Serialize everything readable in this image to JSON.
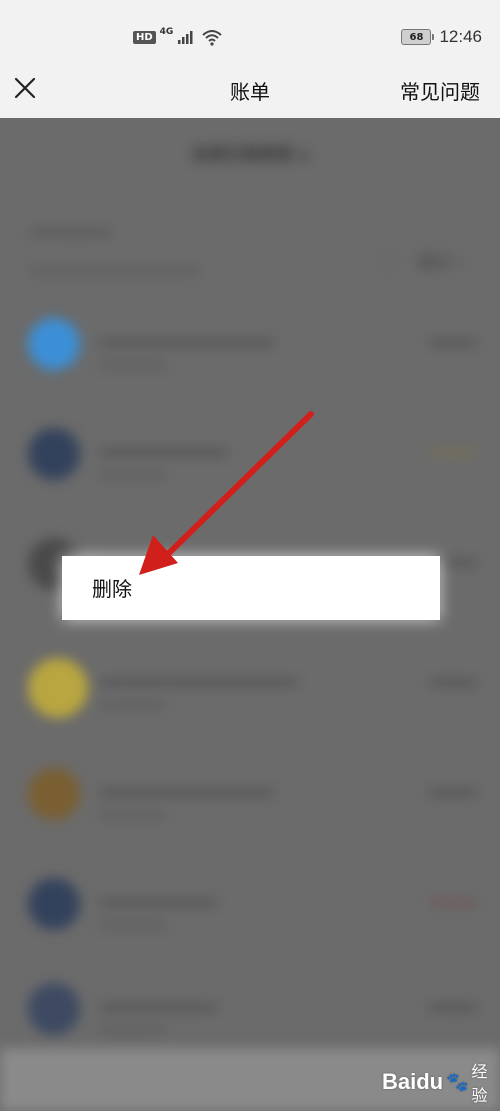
{
  "status_bar": {
    "hd": "HD",
    "network": "4G",
    "battery": "68",
    "time": "12:46"
  },
  "header": {
    "title": "账单",
    "faq": "常见问题",
    "close_icon": "close-icon"
  },
  "filter": {
    "label": "全部交易类型",
    "icon": "caret-down-icon"
  },
  "stats": {
    "label": "统计"
  },
  "context_menu": {
    "items": [
      "删除"
    ]
  },
  "watermark": {
    "brand": "Baidu",
    "suffix": "经验"
  },
  "colors": {
    "arrow": "#d1201b",
    "backdrop": "#6b6b6b"
  }
}
